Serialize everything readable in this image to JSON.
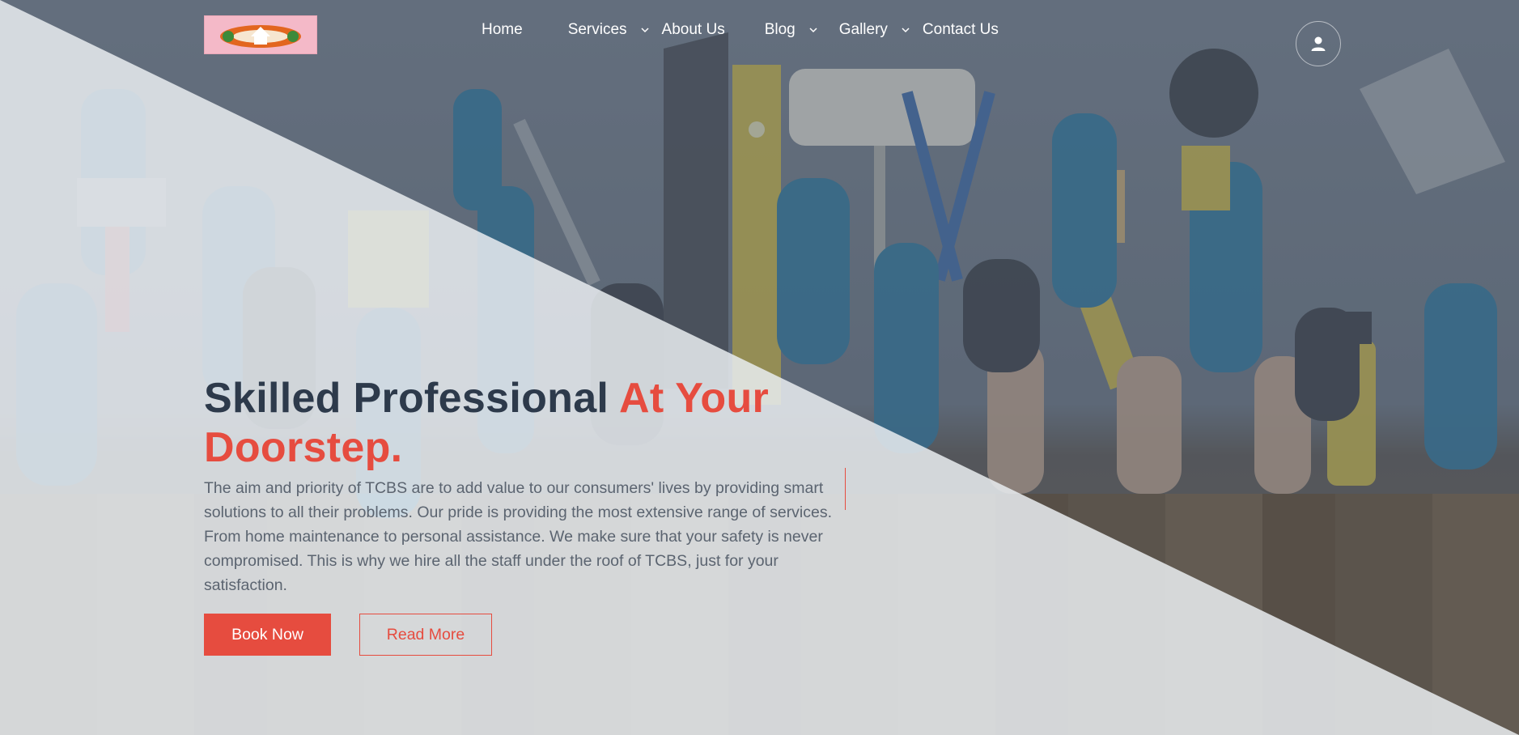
{
  "header": {
    "logo_alt": "TCBS logo",
    "nav": [
      {
        "label": "Home",
        "has_dropdown": false
      },
      {
        "label": "Services",
        "has_dropdown": true
      },
      {
        "label": "About Us",
        "has_dropdown": false
      },
      {
        "label": "Blog",
        "has_dropdown": true
      },
      {
        "label": "Gallery",
        "has_dropdown": true
      },
      {
        "label": "Contact Us",
        "has_dropdown": false
      }
    ],
    "user_icon": "user-icon"
  },
  "hero": {
    "title_main": "Skilled Professional ",
    "title_accent_1": "At Your",
    "title_accent_2": "Doorstep.",
    "description": "The aim and priority of TCBS are to add value to our consumers' lives by providing smart solutions to all their problems. Our pride is providing the most extensive range of services. From home maintenance to personal assistance. We make sure that your safety is never compromised. This is why we hire all the staff under the roof of TCBS, just for your satisfaction.",
    "book_label": "Book Now",
    "read_label": "Read More"
  },
  "colors": {
    "accent": "#e64c3f",
    "heading": "#2d3a4b",
    "text": "#5b6470",
    "overlay_dark": "#5d6876",
    "overlay_light": "#e9ecf0"
  }
}
